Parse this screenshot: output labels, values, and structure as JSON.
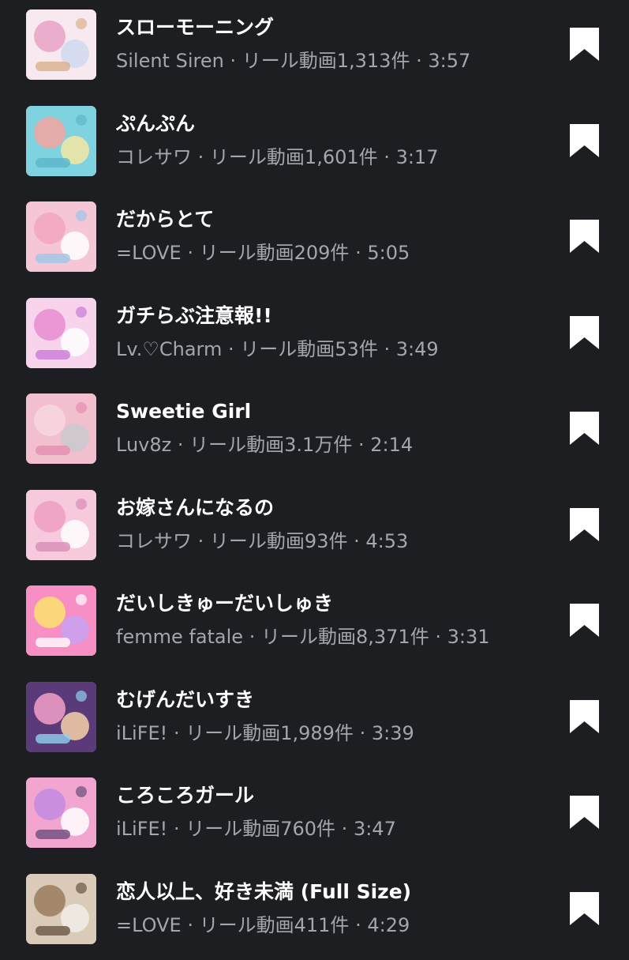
{
  "songs": [
    {
      "title": "スローモーニング",
      "artist": "Silent Siren",
      "reels": "リール動画1,313件",
      "duration": "3:57",
      "sep": "·",
      "art": {
        "bg": "#f7e9ef",
        "c1": "#e7a3c5",
        "c2": "#cfd9f0",
        "c3": "#d9b08a"
      }
    },
    {
      "title": "ぷんぷん",
      "artist": "コレサワ",
      "reels": "リール動画1,601件",
      "duration": "3:17",
      "sep": "·",
      "art": {
        "bg": "#7fd2df",
        "c1": "#f6a6a0",
        "c2": "#f4e7a3",
        "c3": "#5db6c9"
      }
    },
    {
      "title": "だからとて",
      "artist": "=LOVE",
      "reels": "リール動画209件",
      "duration": "5:05",
      "sep": "·",
      "art": {
        "bg": "#f5c7d6",
        "c1": "#f2a6c0",
        "c2": "#ffffff",
        "c3": "#9dc7e8"
      }
    },
    {
      "title": "ガチらぶ注意報!!",
      "artist": "Lv.♡Charm",
      "reels": "リール動画53件",
      "duration": "3:49",
      "sep": "·",
      "art": {
        "bg": "#f7d4ec",
        "c1": "#e98cd1",
        "c2": "#ffffff",
        "c3": "#c97ad8"
      }
    },
    {
      "title": "Sweetie Girl",
      "artist": "Luv8z",
      "reels": "リール動画3.1万件",
      "duration": "2:14",
      "sep": "·",
      "art": {
        "bg": "#f2bfcf",
        "c1": "#f7d7e1",
        "c2": "#c9c9cf",
        "c3": "#e58fb0"
      }
    },
    {
      "title": "お嫁さんになるの",
      "artist": "コレサワ",
      "reels": "リール動画93件",
      "duration": "4:53",
      "sep": "·",
      "art": {
        "bg": "#f6c9dc",
        "c1": "#ee9ec2",
        "c2": "#ffffff",
        "c3": "#d98cb6"
      }
    },
    {
      "title": "だいしきゅーだいしゅき",
      "artist": "femme fatale",
      "reels": "リール動画8,371件",
      "duration": "3:31",
      "sep": "·",
      "art": {
        "bg": "#f78fc4",
        "c1": "#fde36d",
        "c2": "#c8a2f2",
        "c3": "#ffffff"
      }
    },
    {
      "title": "むげんだいすき",
      "artist": "iLiFE!",
      "reels": "リール動画1,989件",
      "duration": "3:39",
      "sep": "·",
      "art": {
        "bg": "#5b3a7a",
        "c1": "#f3a0c8",
        "c2": "#f6d1a8",
        "c3": "#8fd0f0"
      }
    },
    {
      "title": "ころころガール",
      "artist": "iLiFE!",
      "reels": "リール動画760件",
      "duration": "3:47",
      "sep": "·",
      "art": {
        "bg": "#f2a5cf",
        "c1": "#c28ae0",
        "c2": "#ffffff",
        "c3": "#6b4d7a"
      }
    },
    {
      "title": "恋人以上、好き未満 (Full Size)",
      "artist": "=LOVE",
      "reels": "リール動画411件",
      "duration": "4:29",
      "sep": "·",
      "art": {
        "bg": "#d9cbb8",
        "c1": "#9a7c5e",
        "c2": "#f1ede6",
        "c3": "#6a5544"
      }
    }
  ],
  "icons": {
    "save": "bookmark-icon",
    "save_color": "#ffffff"
  }
}
